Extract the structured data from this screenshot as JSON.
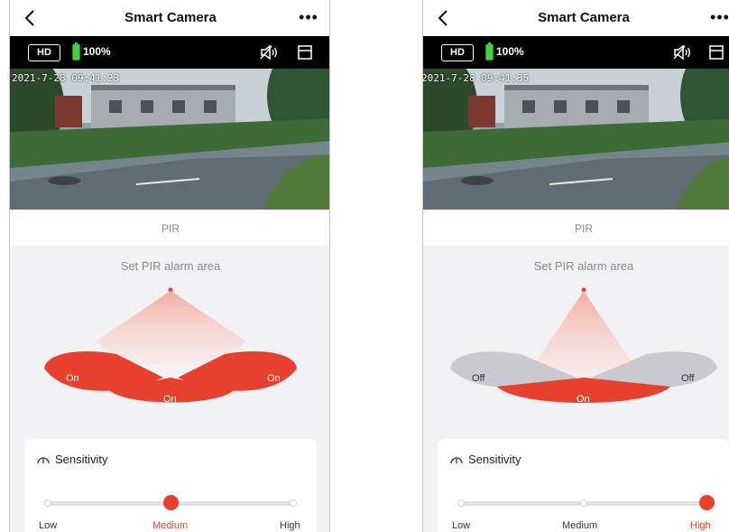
{
  "screens": [
    {
      "header": {
        "title": "Smart Camera"
      },
      "status": {
        "quality_badge": "HD",
        "battery_text": "100%"
      },
      "video": {
        "timestamp": "2021-7-28 09:41:23"
      },
      "panel": {
        "title": "PIR",
        "subtitle": "Set PIR alarm area"
      },
      "zones": [
        {
          "label": "On",
          "state": "on"
        },
        {
          "label": "On",
          "state": "on"
        },
        {
          "label": "On",
          "state": "on"
        }
      ],
      "sensitivity": {
        "label": "Sensitivity",
        "levels": [
          "Low",
          "Medium",
          "High"
        ],
        "selected_index": 1
      }
    },
    {
      "header": {
        "title": "Smart Camera"
      },
      "status": {
        "quality_badge": "HD",
        "battery_text": "100%"
      },
      "video": {
        "timestamp": "2021-7-28 09:41:35"
      },
      "panel": {
        "title": "PIR",
        "subtitle": "Set PIR alarm area"
      },
      "zones": [
        {
          "label": "Off",
          "state": "off"
        },
        {
          "label": "On",
          "state": "on"
        },
        {
          "label": "Off",
          "state": "off"
        }
      ],
      "sensitivity": {
        "label": "Sensitivity",
        "levels": [
          "Low",
          "Medium",
          "High"
        ],
        "selected_index": 2
      }
    }
  ],
  "colors": {
    "accent": "#e8402e",
    "zone_off": "#c9c9cf",
    "battery": "#3fd33f"
  },
  "icons": [
    "back-arrow-icon",
    "more-dots-icon",
    "mute-speaker-icon",
    "layout-icon",
    "battery-icon",
    "sensitivity-icon"
  ]
}
